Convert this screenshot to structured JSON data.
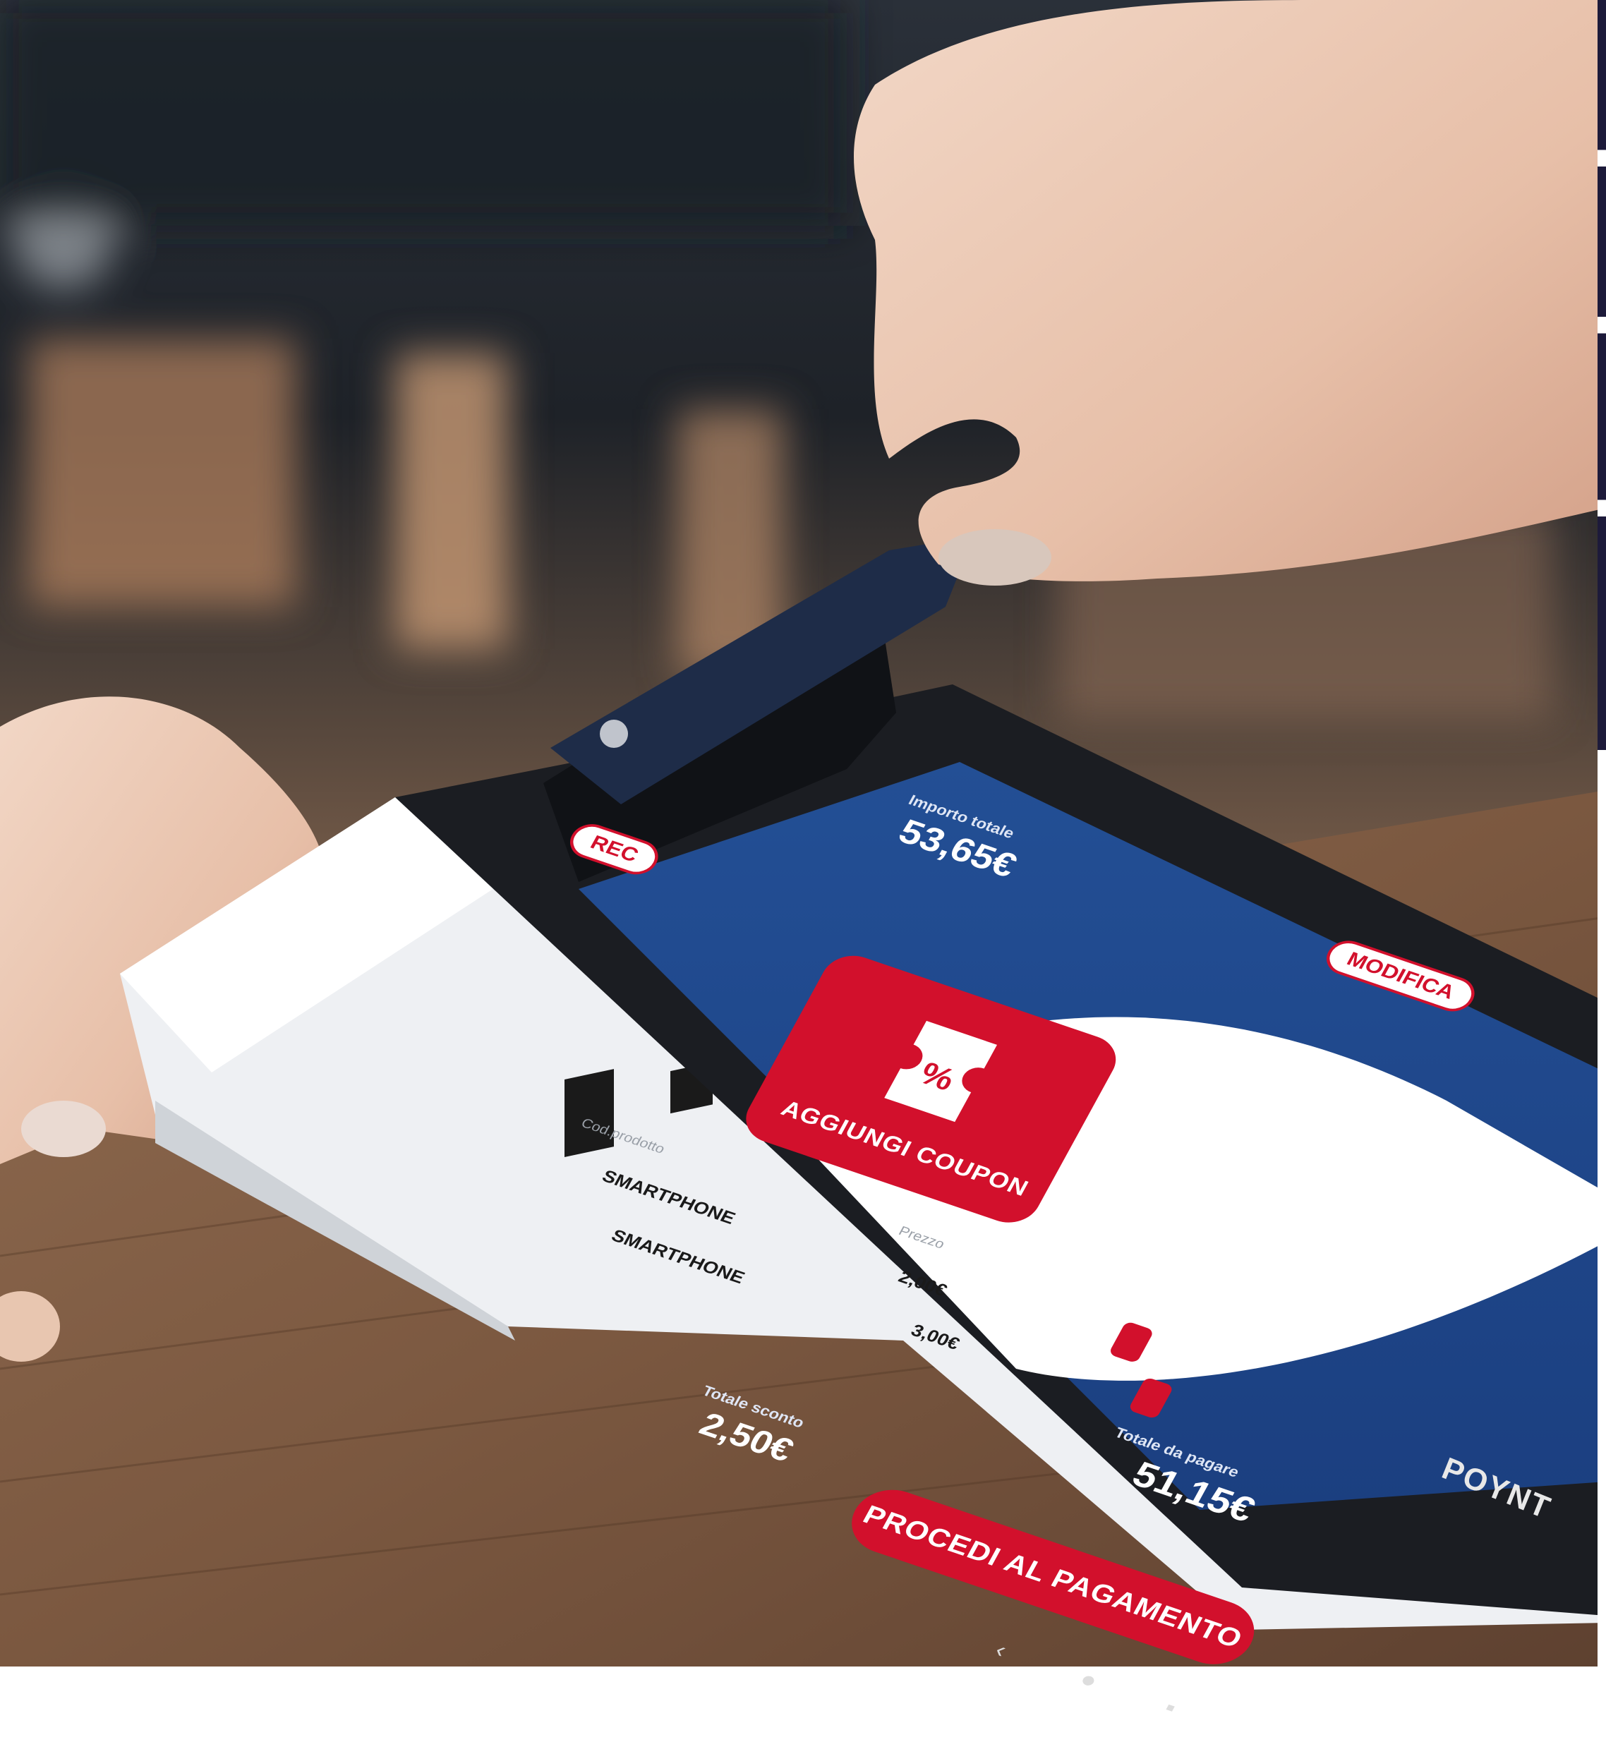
{
  "screen": {
    "top_left_badge": "REC",
    "top_right_badge": "MODIFICA",
    "total_label": "Importo totale",
    "total_value": "53,65€",
    "coupon_label": "AGGIUNGI COUPON",
    "list_headers": [
      "Cod.prodotto",
      "Prezzo"
    ],
    "items": [
      {
        "name": "SMARTPHONE",
        "price": "2,00€"
      },
      {
        "name": "SMARTPHONE",
        "price": "3,00€"
      }
    ],
    "discount_label": "Totale sconto",
    "discount_value": "2,50€",
    "grand_total_label": "Totale da pagare",
    "grand_total_value": "51,15€",
    "pay_button": "PROCEDI AL PAGAMENTO"
  },
  "device_brand": "POYNT",
  "colors": {
    "screen_blue": "#1f4f95",
    "accent_red": "#d2102c",
    "device_white": "#f2f3f5",
    "wood": "#8a6446"
  }
}
